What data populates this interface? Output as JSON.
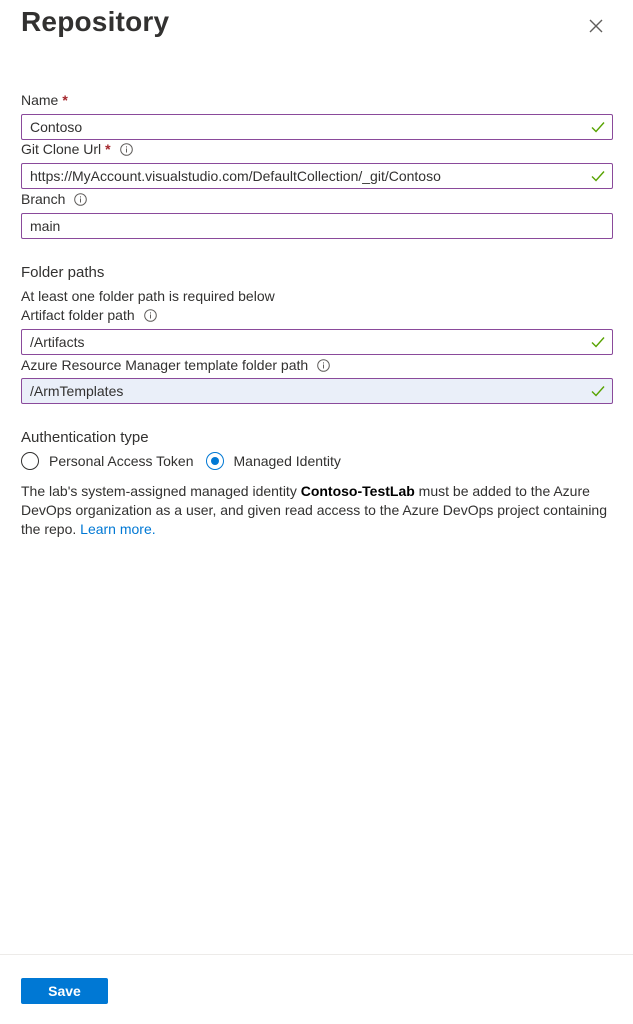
{
  "panel": {
    "title": "Repository"
  },
  "fields": {
    "name": {
      "label": "Name",
      "required": "*",
      "value": "Contoso"
    },
    "git_clone_url": {
      "label": "Git Clone Url",
      "required": "*",
      "value": "https://MyAccount.visualstudio.com/DefaultCollection/_git/Contoso"
    },
    "branch": {
      "label": "Branch",
      "value": "main"
    },
    "artifact_path": {
      "label": "Artifact folder path",
      "value": "/Artifacts"
    },
    "arm_path": {
      "label": "Azure Resource Manager template folder path",
      "value": "/ArmTemplates"
    }
  },
  "folder_paths": {
    "heading": "Folder paths",
    "hint": "At least one folder path is required below"
  },
  "auth": {
    "heading": "Authentication type",
    "options": [
      {
        "label": "Personal Access Token",
        "selected": false
      },
      {
        "label": "Managed Identity",
        "selected": true
      }
    ],
    "description_pre": "The lab's system-assigned managed identity ",
    "identity_name": "Contoso-TestLab",
    "description_post": " must be added to the Azure DevOps organization as a user, and given read access to the Azure DevOps project containing the repo. ",
    "learn_more": "Learn more."
  },
  "footer": {
    "save_label": "Save"
  },
  "colors": {
    "accent": "#0078d4",
    "required": "#a4262c",
    "field_border": "#8a4a9b",
    "valid_check": "#57a300"
  },
  "icons": {
    "close": "close-icon",
    "info": "info-icon",
    "valid": "checkmark-icon"
  }
}
